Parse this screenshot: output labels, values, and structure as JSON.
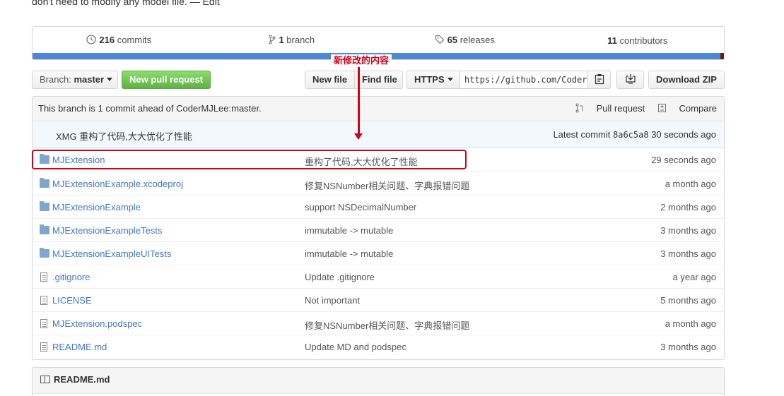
{
  "repo_description": {
    "text": "don't need to modify any model file. — ",
    "edit_label": "Edit"
  },
  "summary": {
    "commits_count": "216",
    "commits_label": "commits",
    "branch_count": "1",
    "branch_label": "branch",
    "releases_count": "65",
    "releases_label": "releases",
    "contributors_count": "11",
    "contributors_label": "contributors",
    "language_colors": [
      "#4f87d8",
      "#6b1b1b"
    ]
  },
  "annotation": {
    "label": "新修改的内容",
    "color": "#d0021b"
  },
  "toolbar": {
    "branch_prefix": "Branch:",
    "branch_name": "master",
    "new_pull_request": "New pull request",
    "new_file": "New file",
    "find_file": "Find file",
    "clone_protocol": "HTTPS",
    "clone_url": "https://github.com/CoderJ",
    "download_zip": "Download ZIP"
  },
  "ahead_notice": {
    "text": "This branch is 1 commit ahead of CoderMJLee:master.",
    "pull_request": "Pull request",
    "compare": "Compare"
  },
  "latest_commit": {
    "message": "XMG 重构了代码,大大优化了性能",
    "prefix": "Latest commit",
    "sha": "8a6c5a8",
    "age": "30 seconds ago"
  },
  "files": [
    {
      "type": "dir",
      "name": "MJExtension",
      "message": "重构了代码,大大优化了性能",
      "age": "29 seconds ago"
    },
    {
      "type": "dir",
      "name": "MJExtensionExample.xcodeproj",
      "message": "修复NSNumber相关问题、字典报错问题",
      "age": "a month ago"
    },
    {
      "type": "dir",
      "name": "MJExtensionExample",
      "message": "support NSDecimalNumber",
      "age": "2 months ago"
    },
    {
      "type": "dir",
      "name": "MJExtensionExampleTests",
      "message": "immutable -> mutable",
      "age": "3 months ago"
    },
    {
      "type": "dir",
      "name": "MJExtensionExampleUITests",
      "message": "immutable -> mutable",
      "age": "3 months ago"
    },
    {
      "type": "file",
      "name": ".gitignore",
      "message": "Update .gitignore",
      "age": "a year ago"
    },
    {
      "type": "file",
      "name": "LICENSE",
      "message": "Not important",
      "age": "5 months ago"
    },
    {
      "type": "file",
      "name": "MJExtension.podspec",
      "message": "修复NSNumber相关问题、字典报错问题",
      "age": "a month ago"
    },
    {
      "type": "file",
      "name": "README.md",
      "message": "Update MD and podspec",
      "age": "3 months ago"
    }
  ],
  "readme": {
    "title": "README.md"
  }
}
